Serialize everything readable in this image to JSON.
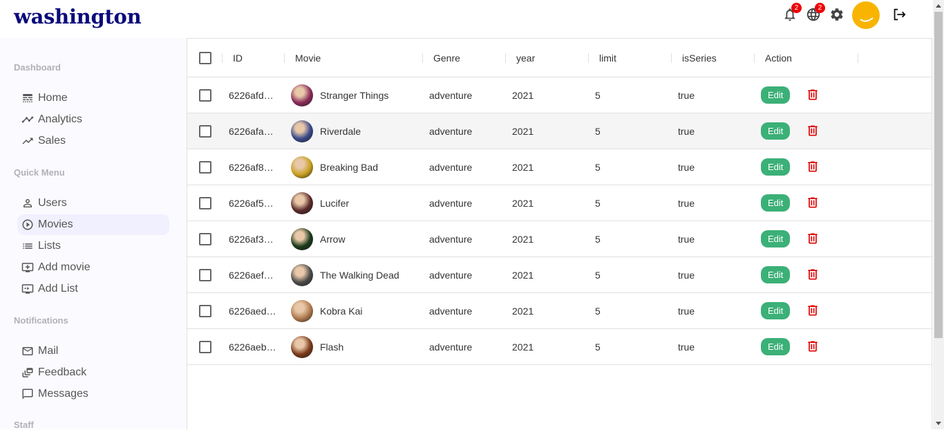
{
  "app": {
    "logo": "washington"
  },
  "topbar": {
    "notifications_count": "2",
    "language_count": "2"
  },
  "sidebar": {
    "sections": [
      {
        "title": "Dashboard",
        "items": [
          {
            "label": "Home",
            "icon": "line-style-icon"
          },
          {
            "label": "Analytics",
            "icon": "timeline-icon"
          },
          {
            "label": "Sales",
            "icon": "trending-up-icon"
          }
        ]
      },
      {
        "title": "Quick Menu",
        "items": [
          {
            "label": "Users",
            "icon": "person-outline-icon"
          },
          {
            "label": "Movies",
            "icon": "play-circle-icon"
          },
          {
            "label": "Lists",
            "icon": "list-icon"
          },
          {
            "label": "Add movie",
            "icon": "add-to-queue-icon"
          },
          {
            "label": "Add List",
            "icon": "queue-play-icon"
          }
        ]
      },
      {
        "title": "Notifications",
        "items": [
          {
            "label": "Mail",
            "icon": "mail-icon"
          },
          {
            "label": "Feedback",
            "icon": "dynamic-feed-icon"
          },
          {
            "label": "Messages",
            "icon": "chat-bubble-icon"
          }
        ]
      },
      {
        "title": "Staff",
        "items": []
      }
    ],
    "active_item": "Movies"
  },
  "grid": {
    "columns": [
      "ID",
      "Movie",
      "Genre",
      "year",
      "limit",
      "isSeries",
      "Action"
    ],
    "edit_label": "Edit",
    "rows": [
      {
        "id": "6226afd…",
        "movie": "Stranger Things",
        "genre": "adventure",
        "year": "2021",
        "limit": "5",
        "isSeries": "true",
        "thumb_color": "#8a2a5a"
      },
      {
        "id": "6226afa…",
        "movie": "Riverdale",
        "genre": "adventure",
        "year": "2021",
        "limit": "5",
        "isSeries": "true",
        "thumb_color": "#3a4a8a"
      },
      {
        "id": "6226af8…",
        "movie": "Breaking Bad",
        "genre": "adventure",
        "year": "2021",
        "limit": "5",
        "isSeries": "true",
        "thumb_color": "#c8a020"
      },
      {
        "id": "6226af5…",
        "movie": "Lucifer",
        "genre": "adventure",
        "year": "2021",
        "limit": "5",
        "isSeries": "true",
        "thumb_color": "#5a2a2a"
      },
      {
        "id": "6226af3…",
        "movie": "Arrow",
        "genre": "adventure",
        "year": "2021",
        "limit": "5",
        "isSeries": "true",
        "thumb_color": "#1a3a1a"
      },
      {
        "id": "6226aef…",
        "movie": "The Walking Dead",
        "genre": "adventure",
        "year": "2021",
        "limit": "5",
        "isSeries": "true",
        "thumb_color": "#4a4a4a"
      },
      {
        "id": "6226aed…",
        "movie": "Kobra Kai",
        "genre": "adventure",
        "year": "2021",
        "limit": "5",
        "isSeries": "true",
        "thumb_color": "#b07a50"
      },
      {
        "id": "6226aeb…",
        "movie": "Flash",
        "genre": "adventure",
        "year": "2021",
        "limit": "5",
        "isSeries": "true",
        "thumb_color": "#7a3a1a"
      }
    ],
    "selected_row": 1
  },
  "colors": {
    "logo": "#0a0a7a",
    "edit": "#3bb077",
    "delete": "#dd0000",
    "avatar": "#f8b400"
  }
}
